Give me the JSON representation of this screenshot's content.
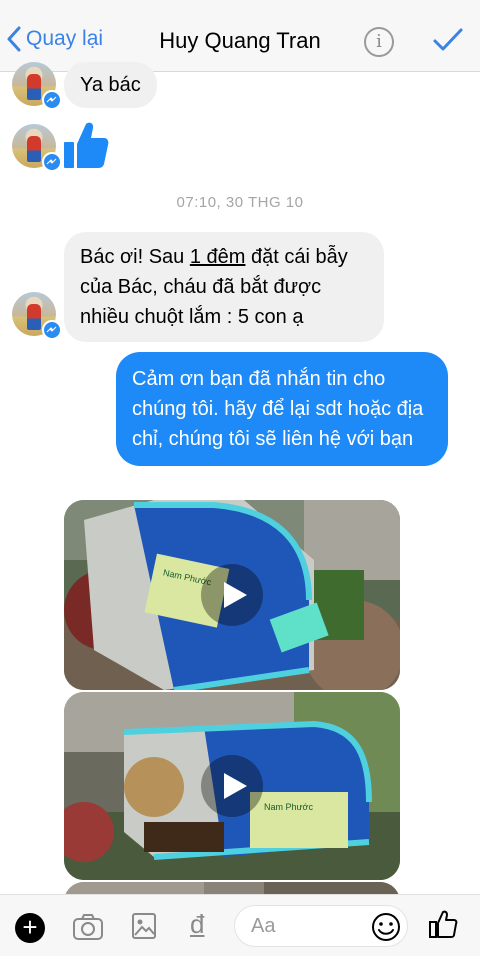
{
  "header": {
    "back_label": "Quay lại",
    "title": "Huy Quang Tran",
    "info_symbol": "i",
    "accent_color": "#3b82e6"
  },
  "messages": [
    {
      "type": "incoming_text",
      "text": "Ya bác"
    },
    {
      "type": "incoming_like",
      "icon": "thumbs-up-icon"
    },
    {
      "type": "timestamp",
      "text": "07:10, 30 THG 10"
    },
    {
      "type": "incoming_text",
      "parts": [
        "Bác ơi! Sau ",
        "1 đêm",
        " đặt cái bẫy của Bác, cháu đã bắt được nhiều chuột lắm : 5 con ạ"
      ]
    },
    {
      "type": "outgoing_text",
      "text": "Cảm ơn bạn đã nhắn tin cho chúng tôi. hãy để lại sdt hoặc địa chỉ, chúng tôi sẽ liên hệ với bạn",
      "color": "#1e8af8"
    },
    {
      "type": "video",
      "icon": "play-icon"
    },
    {
      "type": "video",
      "icon": "play-icon"
    },
    {
      "type": "video",
      "icon": "play-icon"
    }
  ],
  "trap": {
    "brand_text": "Nam Phước"
  },
  "composer": {
    "plus_symbol": "+",
    "currency_symbol": "đ",
    "input_placeholder": "Aa",
    "icons": [
      "plus-icon",
      "camera-icon",
      "image-icon",
      "dong-icon",
      "emoji-icon",
      "thumbs-up-icon"
    ]
  }
}
